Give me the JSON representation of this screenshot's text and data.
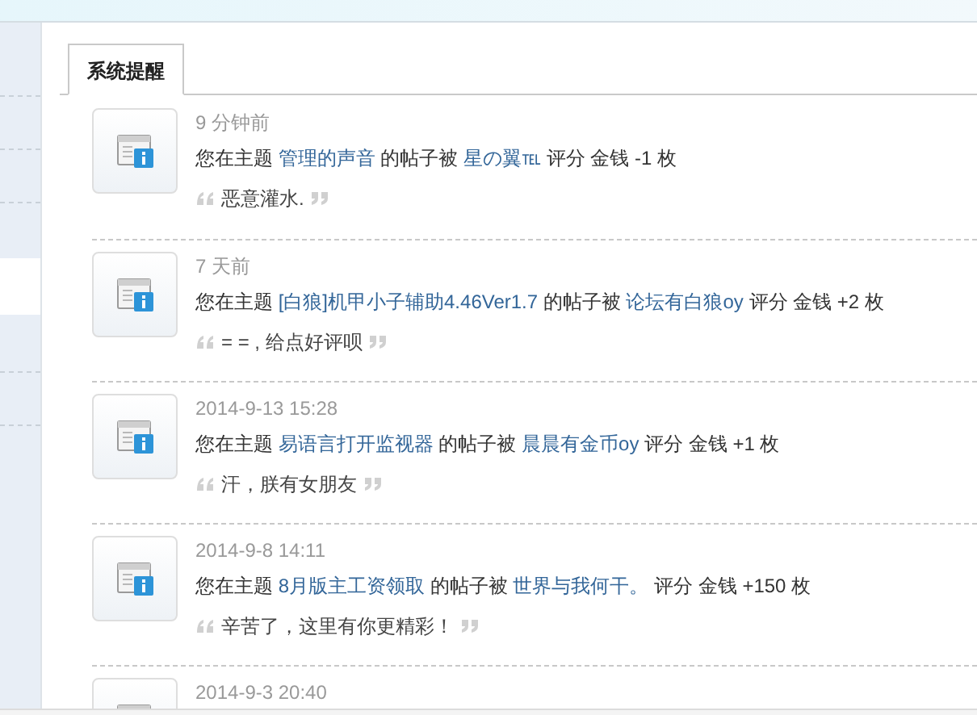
{
  "tabs": [
    {
      "label": "系统提醒",
      "selected": true
    }
  ],
  "notices": [
    {
      "time": "9 分钟前",
      "prefix": "您在主题",
      "topic": "管理的声音",
      "middle": "的帖子被",
      "user": "星の翼℡",
      "suffix": "评分 金钱 -1 枚",
      "comment": "恶意灌水."
    },
    {
      "time": "7 天前",
      "prefix": "您在主题",
      "topic": "[白狼]机甲小子辅助4.46Ver1.7",
      "middle": "的帖子被",
      "user": "论坛有白狼oy",
      "suffix": "评分 金钱 +2 枚",
      "comment": "= = , 给点好评呗"
    },
    {
      "time": "2014-9-13 15:28",
      "prefix": "您在主题",
      "topic": "易语言打开监视器",
      "middle": "的帖子被",
      "user": "晨晨有金币oy",
      "suffix": "评分 金钱 +1 枚",
      "comment": "汗，朕有女朋友"
    },
    {
      "time": "2014-9-8 14:11",
      "prefix": "您在主题",
      "topic": "8月版主工资领取",
      "middle": "的帖子被",
      "user": "世界与我何干。",
      "suffix": "评分 金钱 +150 枚",
      "comment": "辛苦了，这里有你更精彩！"
    },
    {
      "time": "2014-9-3 20:40"
    }
  ]
}
